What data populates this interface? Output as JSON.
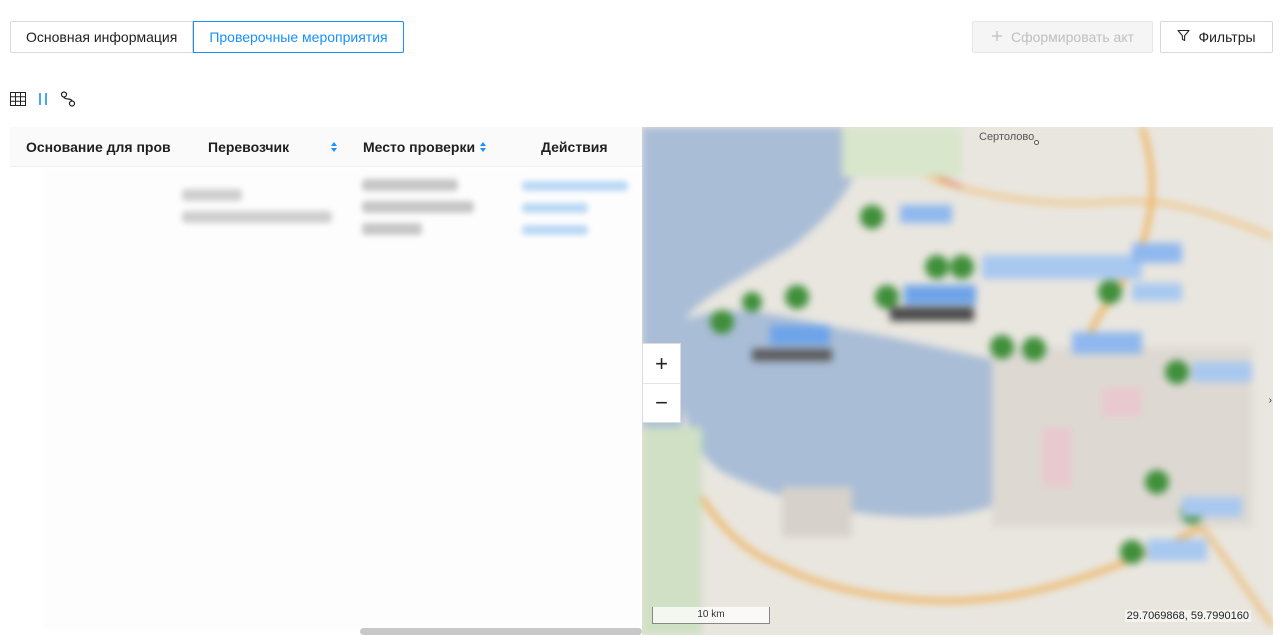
{
  "tabs": [
    {
      "label": "Основная информация",
      "active": false
    },
    {
      "label": "Проверочные мероприятия",
      "active": true
    }
  ],
  "toolbar": {
    "act_label": "Сформировать акт",
    "filter_label": "Фильтры"
  },
  "view_switch": {
    "icons": [
      "table-icon",
      "split-view-icon",
      "map-route-icon"
    ],
    "active": "split-view-icon"
  },
  "table": {
    "columns": [
      {
        "label": "Основание для пров",
        "sortable": false
      },
      {
        "label": "Перевозчик",
        "sortable": true
      },
      {
        "label": "Место проверки",
        "sortable": true
      },
      {
        "label": "Действия",
        "sortable": false
      }
    ]
  },
  "map": {
    "place_label": "Сертолово",
    "scale_label": "10 km",
    "coordinates": "29.7069868, 59.7990160",
    "zoom_in": "+",
    "zoom_out": "−",
    "colors": {
      "water": "#a9bdd6",
      "land": "#e9e6df",
      "road": "#f0a43a",
      "marker": "#3f8f3a",
      "label_box": "#8fb8ee"
    }
  },
  "colors": {
    "accent": "#1890ff"
  }
}
